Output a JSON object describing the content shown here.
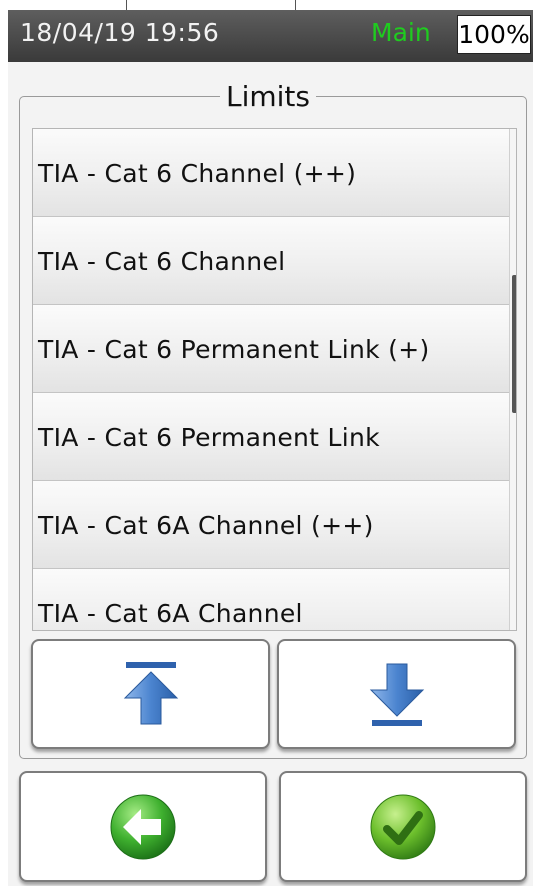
{
  "status": {
    "datetime": "18/04/19 19:56",
    "mode": "Main",
    "battery": "100%"
  },
  "group": {
    "title": "Limits"
  },
  "list": {
    "items": [
      "TIA - Cat 6 Channel (++)",
      "TIA - Cat 6 Channel",
      "TIA - Cat 6 Permanent Link (+)",
      "TIA - Cat 6 Permanent Link",
      "TIA - Cat 6A Channel (++)",
      "TIA - Cat 6A Channel"
    ],
    "scroll_position": 0.4
  },
  "buttons": {
    "scroll_top_icon": "arrow-up-to-bar-icon",
    "scroll_bottom_icon": "arrow-down-to-bar-icon",
    "back_icon": "green-back-arrow-icon",
    "confirm_icon": "green-checkmark-icon"
  },
  "colors": {
    "mode_text": "#1fcc1f",
    "arrow_blue": "#3a74c4",
    "button_green": "#3aa52c"
  }
}
